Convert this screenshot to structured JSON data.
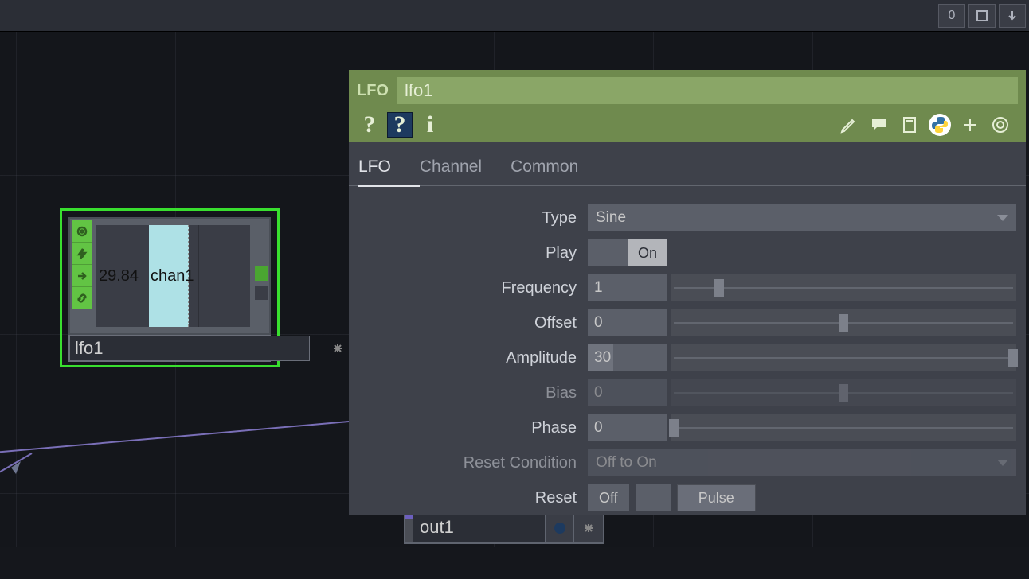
{
  "window": {
    "btn0_label": "0"
  },
  "node_lfo": {
    "value": "29.84",
    "channel": "chan1",
    "name": "lfo1"
  },
  "node_out": {
    "name": "out1"
  },
  "panel": {
    "type_label": "LFO",
    "op_name": "lfo1",
    "tabs": {
      "lfo": "LFO",
      "channel": "Channel",
      "common": "Common"
    },
    "params": {
      "type": {
        "label": "Type",
        "value": "Sine"
      },
      "play": {
        "label": "Play",
        "value": "On"
      },
      "frequency": {
        "label": "Frequency",
        "value": "1",
        "slider_pct": 14
      },
      "offset": {
        "label": "Offset",
        "value": "0",
        "slider_pct": 50
      },
      "amplitude": {
        "label": "Amplitude",
        "value": "30",
        "slider_pct": 99
      },
      "bias": {
        "label": "Bias",
        "value": "0",
        "slider_pct": 50
      },
      "phase": {
        "label": "Phase",
        "value": "0",
        "slider_pct": 1
      },
      "reset_cond": {
        "label": "Reset Condition",
        "value": "Off to On"
      },
      "reset": {
        "label": "Reset",
        "off": "Off",
        "pulse": "Pulse"
      }
    }
  }
}
